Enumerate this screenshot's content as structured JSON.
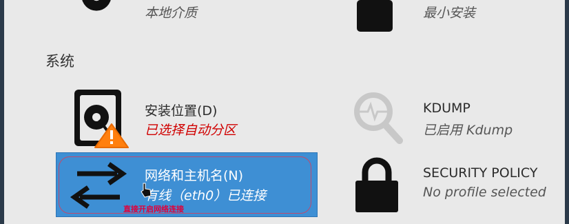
{
  "hub": {
    "top_row": [
      {
        "subtitle": "本地介质",
        "icon": "disc-icon"
      },
      {
        "subtitle": "最小安装",
        "icon": "package-icon"
      }
    ],
    "section_label": "系统",
    "spokes": [
      {
        "title": "安装位置(D)",
        "subtitle": "已选择自动分区",
        "icon": "hard-disk-warning-icon",
        "status": "warning"
      },
      {
        "title": "KDUMP",
        "subtitle": "已启用 Kdump",
        "icon": "magnifier-icon"
      },
      {
        "title": "网络和主机名(N)",
        "subtitle": "有线（eth0）已连接",
        "icon": "network-arrows-icon",
        "selected": true
      },
      {
        "title": "SECURITY POLICY",
        "subtitle": "No profile selected",
        "icon": "lock-icon"
      }
    ]
  },
  "annotation": {
    "text": "直接开启网络连接",
    "color": "#e0003a"
  },
  "colors": {
    "selected_bg": "#3e8fd4",
    "warning_text": "#d00000",
    "warning_badge": "#ff7f0e"
  }
}
